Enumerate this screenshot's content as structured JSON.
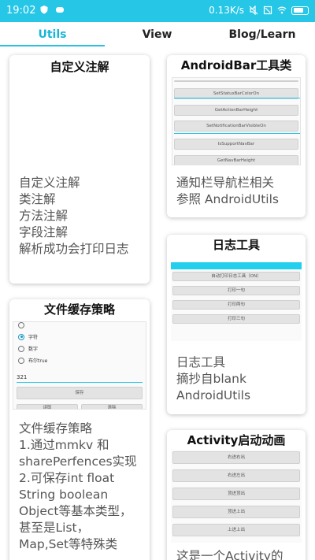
{
  "status_bar": {
    "time": "19:02",
    "net_speed": "0.13K/s",
    "accent": "#26c6e6",
    "icons": [
      "shield-icon",
      "cloud-icon",
      "mute-icon",
      "sim-off-icon",
      "wifi-icon",
      "battery-icon"
    ]
  },
  "tabs": [
    {
      "label": "Utils",
      "active": true
    },
    {
      "label": "View",
      "active": false
    },
    {
      "label": "Blog/Learn",
      "active": false
    }
  ],
  "cards": {
    "annotation": {
      "title": "自定义注解",
      "desc": "自定义注解\n类注解\n方法注解\n字段注解\n解析成功会打印日志"
    },
    "androidbar": {
      "title": "AndroidBar工具类",
      "desc": "通知栏导航栏相关\n参照 AndroidUtils",
      "shot_buttons": [
        "SetStatusBarColorOn",
        "GetActionBarHeight",
        "SetNotificationBarVisibleOn",
        "IsSupportNavBar",
        "GetNavBarHeight"
      ]
    },
    "log": {
      "title": "日志工具",
      "desc": "日志工具\n摘抄自blank\nAndroidUtils",
      "shot_buttons": [
        "自动打印日志工具（ON）",
        "打印一句",
        "打印两句",
        "打印三句"
      ]
    },
    "filecache": {
      "title": "文件缓存策略",
      "desc": "文件缓存策略\n  1.通过mmkv 和\nsharePerfences实现\n  2.可保存int float\nString boolean\nObject等基本类型，\n甚至是List，\nMap,Set等特殊类",
      "shot_radios": [
        "字符",
        "数字",
        "布尔true"
      ],
      "shot_input_value": "321",
      "shot_save_label": "保存",
      "shot_bottom_buttons": [
        "读取",
        "清除"
      ]
    },
    "activity_anim": {
      "title": "Activity启动动画",
      "desc": "这是一个Activity的",
      "shot_buttons": [
        "右进右出",
        "右进左出",
        "顶进顶出",
        "顶进上出",
        "上进上出"
      ]
    }
  }
}
